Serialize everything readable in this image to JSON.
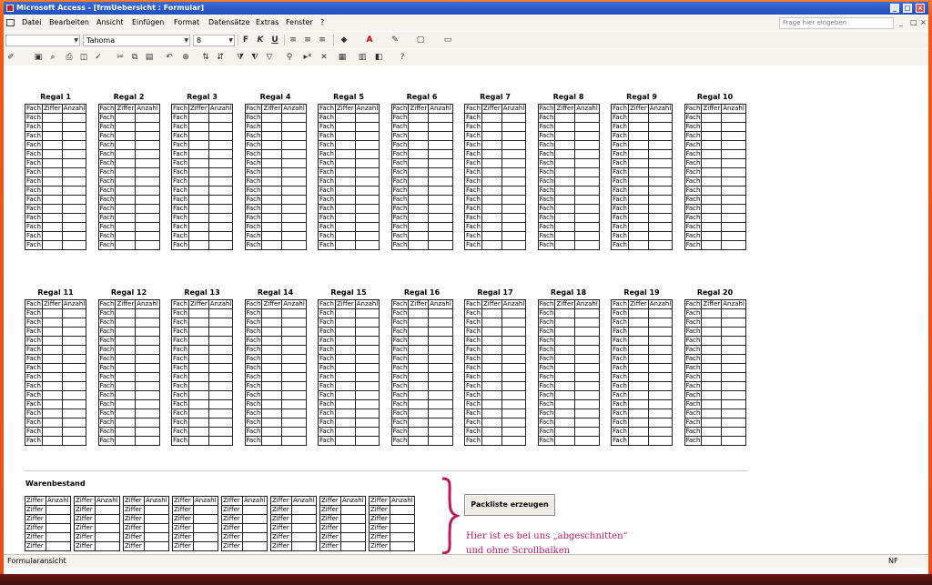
{
  "window": {
    "title": "Microsoft Access - [frmUebersicht : Formular]"
  },
  "menu": {
    "items": [
      "Datei",
      "Bearbeiten",
      "Ansicht",
      "Einfügen",
      "Format",
      "Datensätze",
      "Extras",
      "Fenster",
      "?"
    ],
    "help_placeholder": "Frage hier eingeben",
    "mdi_buttons": [
      "_",
      "□",
      "×"
    ]
  },
  "toolbar": {
    "object_combo": "",
    "font": "Tahoma",
    "font_size": "8",
    "bold_label": "F",
    "italic_label": "K",
    "underline_label": "U"
  },
  "form": {
    "regale_row1": [
      "Regal 1",
      "Regal 2",
      "Regal 3",
      "Regal 4",
      "Regal 5",
      "Regal 6",
      "Regal 7",
      "Regal 8",
      "Regal 9",
      "Regal 10"
    ],
    "regale_row2": [
      "Regal 11",
      "Regal 12",
      "Regal 13",
      "Regal 14",
      "Regal 15",
      "Regal 16",
      "Regal 17",
      "Regal 18",
      "Regal 19",
      "Regal 20"
    ],
    "columns": [
      "Fach",
      "Ziffer",
      "Anzahl"
    ],
    "row_label": "Fach",
    "rows_per_regal": 15,
    "warenbestand": {
      "title": "Warenbestand",
      "columns": [
        "Ziffer",
        "Anzahl"
      ],
      "row_label": "Ziffer",
      "blocks": 8,
      "visible_rows": 5
    },
    "pack_button": "Packliste erzeugen",
    "note_line1": "Hier ist es bei uns „abgeschnitten“",
    "note_line2": "und ohne Scrollbalken",
    "note_color": "#c2185b"
  },
  "status": {
    "left": "Formularansicht",
    "right": "NF"
  }
}
